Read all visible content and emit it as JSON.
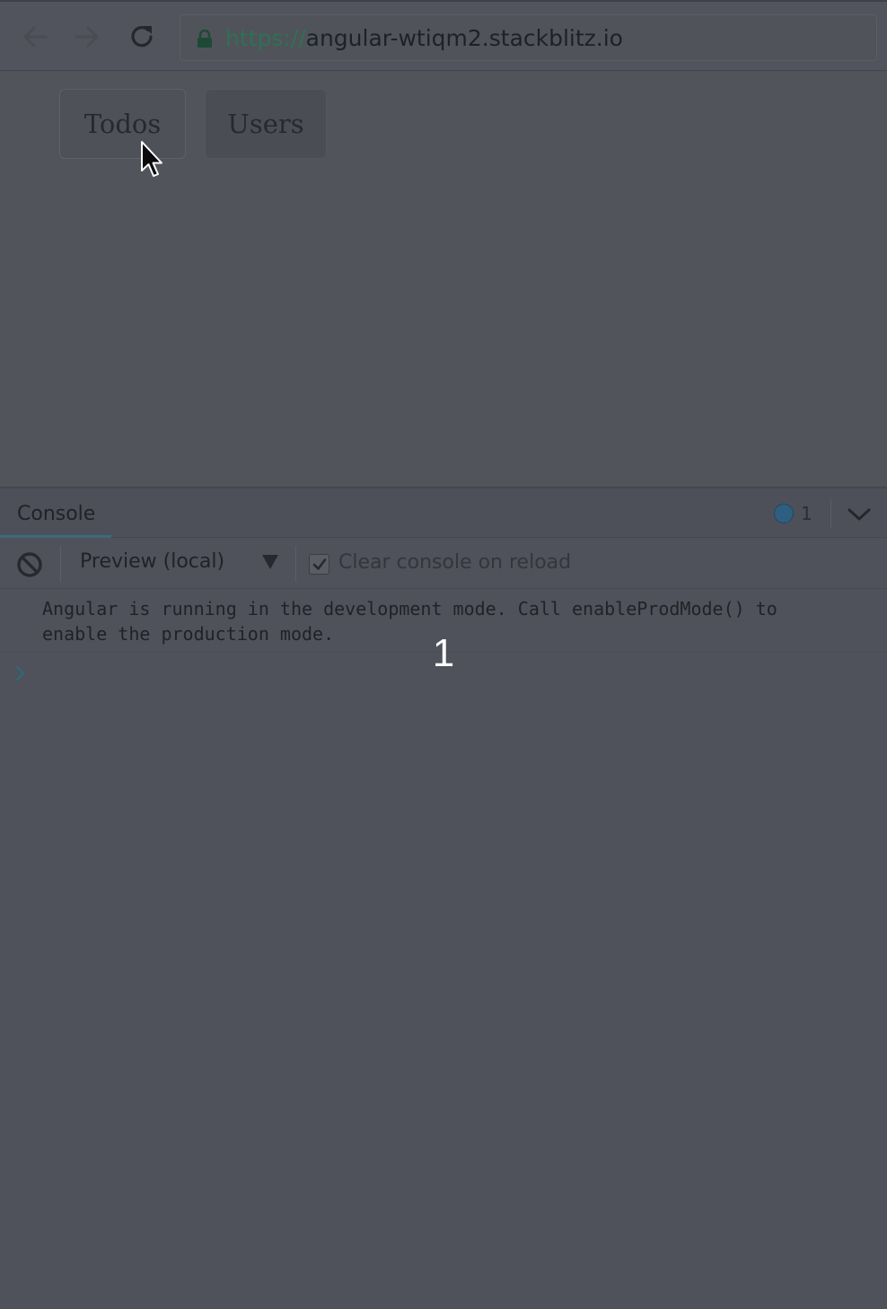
{
  "browser": {
    "url_scheme": "https://",
    "url_host": "angular-wtiqm2.stackblitz.io",
    "icons": {
      "back": "arrow-left-icon",
      "forward": "arrow-right-icon",
      "reload": "reload-icon",
      "lock": "lock-icon"
    }
  },
  "app": {
    "buttons": [
      {
        "label": "Todos"
      },
      {
        "label": "Users"
      }
    ]
  },
  "console": {
    "tab_label": "Console",
    "info_count": "1",
    "context_label": "Preview (local)",
    "clear_on_reload_label": "Clear console on reload",
    "clear_on_reload_checked": true,
    "messages": [
      {
        "text": "Angular is running in the development mode. Call enableProdMode() to\nenable the production mode.",
        "count": "1"
      }
    ]
  },
  "colors": {
    "overlay_background": "#4f525a",
    "secure_scheme": "#2f7153",
    "console_tab_accent": "#3c6b7a",
    "info_badge": "#2f5f80"
  }
}
